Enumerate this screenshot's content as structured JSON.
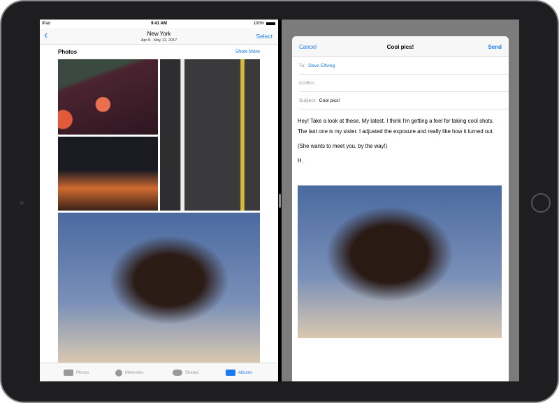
{
  "status": {
    "device": "iPad",
    "time": "9:41 AM",
    "battery": "100%"
  },
  "photos": {
    "title": "New York",
    "subtitle": "Apr 8 - May 12, 2017",
    "select": "Select",
    "section": "Photos",
    "show_more": "Show More",
    "tabs": [
      {
        "label": "Photos"
      },
      {
        "label": "Memories"
      },
      {
        "label": "Shared"
      },
      {
        "label": "Albums",
        "active": true
      }
    ]
  },
  "mail": {
    "cancel": "Cancel",
    "title": "Cool pics!",
    "send": "Send",
    "to_label": "To:",
    "to": "Dave Elfving",
    "cc_label": "Cc/Bcc:",
    "subject_label": "Subject:",
    "subject": "Cool pics!",
    "body": [
      "Hey! Take a look at these. My latest. I think I'm getting a feel for taking cool shots. The last one is my sister. I adjusted the exposure and really like how it turned out.",
      "(She wants to meet you, by the way!)",
      "H."
    ]
  },
  "accent": "#1a7cf5"
}
